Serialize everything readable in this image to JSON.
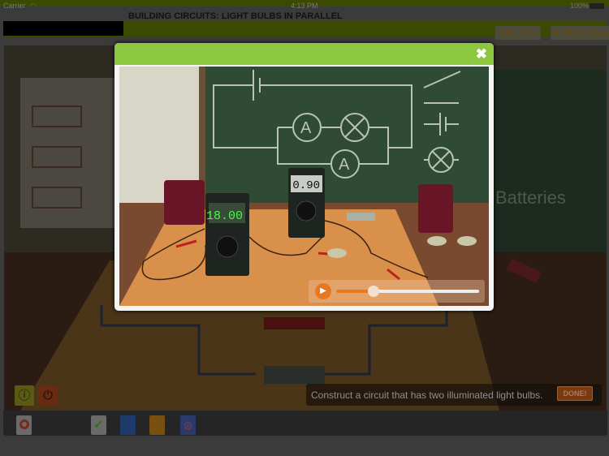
{
  "status_bar": {
    "carrier": "Carrier",
    "time": "4:13 PM",
    "battery": "100%"
  },
  "title": "BUILDING CIRCUITS: LIGHT BULBS IN PARALLEL",
  "header": {
    "glossary": "GLOSSARY",
    "preferences": "PREFERENCES"
  },
  "modal": {
    "close_icon": "close-icon",
    "video": {
      "meter1_reading": "18.00",
      "meter2_reading": "0.90",
      "chalkboard_text": "Batteries",
      "progress": 0.26
    }
  },
  "instruction": {
    "text": "Construct a circuit that has two illuminated light bulbs.",
    "done": "DONE!"
  },
  "colors": {
    "modal_header": "#8dc63f",
    "header_bar": "#3a4a00"
  }
}
